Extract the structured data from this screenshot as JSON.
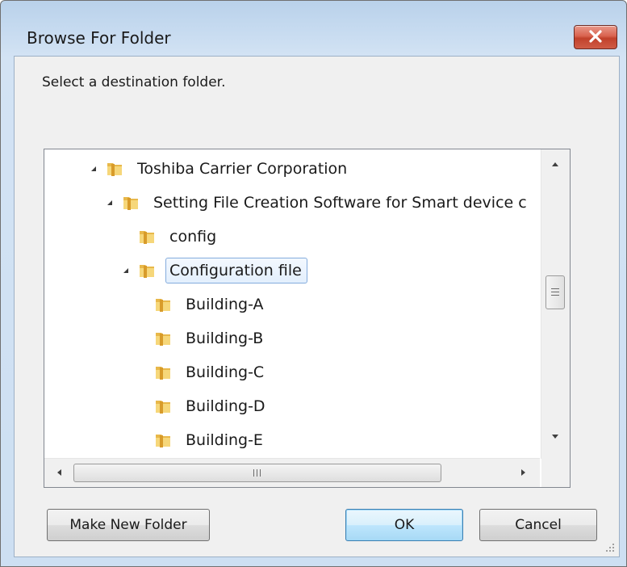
{
  "window": {
    "title": "Browse For Folder",
    "close_icon": "close-x-icon"
  },
  "dialog": {
    "prompt": "Select a destination folder."
  },
  "tree": {
    "items": [
      {
        "label": "Toshiba Carrier Corporation",
        "expanded": true,
        "selected": false,
        "icon": "folder-icon"
      },
      {
        "label": "Setting File Creation Software for Smart device c",
        "expanded": true,
        "selected": false,
        "icon": "folder-icon"
      },
      {
        "label": "config",
        "expanded": false,
        "selected": false,
        "icon": "folder-icon"
      },
      {
        "label": "Configuration file",
        "expanded": true,
        "selected": true,
        "icon": "folder-icon"
      },
      {
        "label": "Building-A",
        "expanded": false,
        "selected": false,
        "icon": "folder-icon"
      },
      {
        "label": "Building-B",
        "expanded": false,
        "selected": false,
        "icon": "folder-icon"
      },
      {
        "label": "Building-C",
        "expanded": false,
        "selected": false,
        "icon": "folder-icon"
      },
      {
        "label": "Building-D",
        "expanded": false,
        "selected": false,
        "icon": "folder-icon"
      },
      {
        "label": "Building-E",
        "expanded": false,
        "selected": false,
        "icon": "folder-icon"
      }
    ]
  },
  "buttons": {
    "make_new_folder": "Make New Folder",
    "ok": "OK",
    "cancel": "Cancel"
  },
  "colors": {
    "accent": "#3c7fb1",
    "close_red": "#c1412b",
    "selection": "#84acdd"
  }
}
